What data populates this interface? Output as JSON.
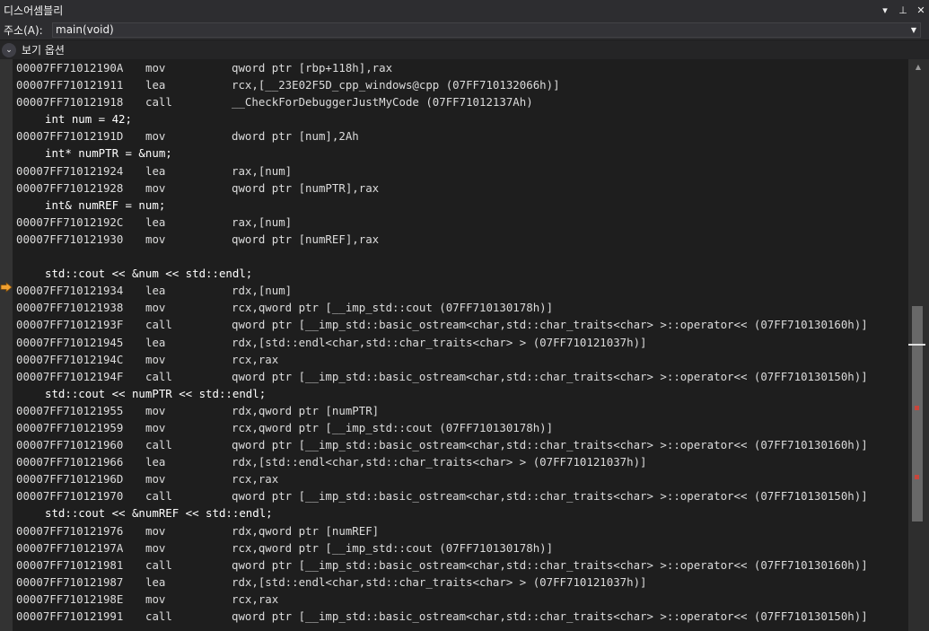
{
  "window": {
    "title": "디스어셈블리",
    "buttons": {
      "dropdown_icon": "▾",
      "pin_icon": "⊥",
      "close_icon": "✕"
    }
  },
  "address": {
    "label": "주소(A):",
    "value": "main(void)",
    "drop_icon": "▼"
  },
  "view_options": {
    "toggle_icon": "⌄",
    "label": "보기 옵션"
  },
  "code": {
    "current_line_index": 12,
    "lines": [
      {
        "type": "asm",
        "addr": "00007FF71012190A",
        "mnemonic": "mov",
        "operands": "qword ptr [rbp+118h],rax"
      },
      {
        "type": "asm",
        "addr": "00007FF710121911",
        "mnemonic": "lea",
        "operands": "rcx,[__23E02F5D_cpp_windows@cpp (07FF710132066h)]"
      },
      {
        "type": "asm",
        "addr": "00007FF710121918",
        "mnemonic": "call",
        "operands": "__CheckForDebuggerJustMyCode (07FF71012137Ah)"
      },
      {
        "type": "src",
        "text": "int num = 42;"
      },
      {
        "type": "asm",
        "addr": "00007FF71012191D",
        "mnemonic": "mov",
        "operands": "dword ptr [num],2Ah"
      },
      {
        "type": "src",
        "text": "int* numPTR = &num;"
      },
      {
        "type": "asm",
        "addr": "00007FF710121924",
        "mnemonic": "lea",
        "operands": "rax,[num]"
      },
      {
        "type": "asm",
        "addr": "00007FF710121928",
        "mnemonic": "mov",
        "operands": "qword ptr [numPTR],rax"
      },
      {
        "type": "src",
        "text": "int& numREF = num;"
      },
      {
        "type": "asm",
        "addr": "00007FF71012192C",
        "mnemonic": "lea",
        "operands": "rax,[num]"
      },
      {
        "type": "asm",
        "addr": "00007FF710121930",
        "mnemonic": "mov",
        "operands": "qword ptr [numREF],rax"
      },
      {
        "type": "blank",
        "text": ""
      },
      {
        "type": "src",
        "text": "std::cout << &num << std::endl;"
      },
      {
        "type": "asm",
        "addr": "00007FF710121934",
        "mnemonic": "lea",
        "operands": "rdx,[num]",
        "current": true
      },
      {
        "type": "asm",
        "addr": "00007FF710121938",
        "mnemonic": "mov",
        "operands": "rcx,qword ptr [__imp_std::cout (07FF710130178h)]"
      },
      {
        "type": "asm",
        "addr": "00007FF71012193F",
        "mnemonic": "call",
        "operands": "qword ptr [__imp_std::basic_ostream<char,std::char_traits<char> >::operator<< (07FF710130160h)]"
      },
      {
        "type": "asm",
        "addr": "00007FF710121945",
        "mnemonic": "lea",
        "operands": "rdx,[std::endl<char,std::char_traits<char> > (07FF710121037h)]"
      },
      {
        "type": "asm",
        "addr": "00007FF71012194C",
        "mnemonic": "mov",
        "operands": "rcx,rax"
      },
      {
        "type": "asm",
        "addr": "00007FF71012194F",
        "mnemonic": "call",
        "operands": "qword ptr [__imp_std::basic_ostream<char,std::char_traits<char> >::operator<< (07FF710130150h)]"
      },
      {
        "type": "src",
        "text": "std::cout << numPTR << std::endl;"
      },
      {
        "type": "asm",
        "addr": "00007FF710121955",
        "mnemonic": "mov",
        "operands": "rdx,qword ptr [numPTR]"
      },
      {
        "type": "asm",
        "addr": "00007FF710121959",
        "mnemonic": "mov",
        "operands": "rcx,qword ptr [__imp_std::cout (07FF710130178h)]"
      },
      {
        "type": "asm",
        "addr": "00007FF710121960",
        "mnemonic": "call",
        "operands": "qword ptr [__imp_std::basic_ostream<char,std::char_traits<char> >::operator<< (07FF710130160h)]"
      },
      {
        "type": "asm",
        "addr": "00007FF710121966",
        "mnemonic": "lea",
        "operands": "rdx,[std::endl<char,std::char_traits<char> > (07FF710121037h)]"
      },
      {
        "type": "asm",
        "addr": "00007FF71012196D",
        "mnemonic": "mov",
        "operands": "rcx,rax"
      },
      {
        "type": "asm",
        "addr": "00007FF710121970",
        "mnemonic": "call",
        "operands": "qword ptr [__imp_std::basic_ostream<char,std::char_traits<char> >::operator<< (07FF710130150h)]"
      },
      {
        "type": "src",
        "text": "std::cout << &numREF << std::endl;"
      },
      {
        "type": "asm",
        "addr": "00007FF710121976",
        "mnemonic": "mov",
        "operands": "rdx,qword ptr [numREF]"
      },
      {
        "type": "asm",
        "addr": "00007FF71012197A",
        "mnemonic": "mov",
        "operands": "rcx,qword ptr [__imp_std::cout (07FF710130178h)]"
      },
      {
        "type": "asm",
        "addr": "00007FF710121981",
        "mnemonic": "call",
        "operands": "qword ptr [__imp_std::basic_ostream<char,std::char_traits<char> >::operator<< (07FF710130160h)]"
      },
      {
        "type": "asm",
        "addr": "00007FF710121987",
        "mnemonic": "lea",
        "operands": "rdx,[std::endl<char,std::char_traits<char> > (07FF710121037h)]"
      },
      {
        "type": "asm",
        "addr": "00007FF71012198E",
        "mnemonic": "mov",
        "operands": "rcx,rax"
      },
      {
        "type": "asm",
        "addr": "00007FF710121991",
        "mnemonic": "call",
        "operands": "qword ptr [__imp_std::basic_ostream<char,std::char_traits<char> >::operator<< (07FF710130150h)]"
      }
    ]
  },
  "scrollbar": {
    "up_icon": "▲"
  },
  "colors": {
    "background": "#1e1e1e",
    "chrome": "#2d2d30",
    "instruction_pointer": "#f0a030",
    "scroll_mark": "#c8463c"
  }
}
